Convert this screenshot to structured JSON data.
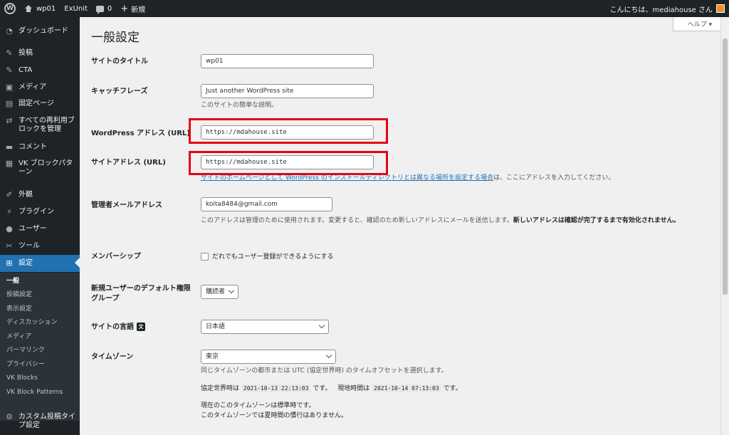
{
  "adminbar": {
    "site_name": "wp01",
    "exunit": "ExUnit",
    "comments_count": "0",
    "new_label": "新規",
    "greeting": "こんにちは、mediahouse さん"
  },
  "sidebar": {
    "dashboard": "ダッシュボード",
    "posts": "投稿",
    "cta": "CTA",
    "media": "メディア",
    "pages": "固定ページ",
    "reusable_blocks": "すべての再利用ブロックを管理",
    "comments": "コメント",
    "vk_block_patterns": "VK ブロックパターン",
    "appearance": "外観",
    "plugins": "プラグイン",
    "users": "ユーザー",
    "tools": "ツール",
    "settings": "設定",
    "submenu": [
      "一般",
      "投稿設定",
      "表示設定",
      "ディスカッション",
      "メディア",
      "パーマリンク",
      "プライバシー",
      "VK Blocks",
      "VK Block Patterns"
    ],
    "custom_post_type": "カスタム投稿タイプ設定"
  },
  "help_label": "ヘルプ ▾",
  "page_title": "一般設定",
  "form": {
    "site_title_label": "サイトのタイトル",
    "site_title_value": "wp01",
    "tagline_label": "キャッチフレーズ",
    "tagline_value": "Just another WordPress site",
    "tagline_desc": "このサイトの簡単な説明。",
    "wp_address_label": "WordPress アドレス (URL)",
    "wp_address_value": "https://mdahouse.site",
    "site_address_label": "サイトアドレス (URL)",
    "site_address_value": "https://mdahouse.site",
    "site_address_desc_link": "サイトのホームページとして WordPress のインストールディレクトリとは異なる場所を設定する場合",
    "site_address_desc_tail": "は、ここにアドレスを入力してください。",
    "admin_email_label": "管理者メールアドレス",
    "admin_email_value": "koita8484@gmail.com",
    "admin_email_desc": "このアドレスは管理のために使用されます。変更すると、確認のため新しいアドレスにメールを送信します。",
    "admin_email_desc_bold": "新しいアドレスは確認が完了するまで有効化されません。",
    "membership_label": "メンバーシップ",
    "membership_checkbox": "だれでもユーザー登録ができるようにする",
    "default_role_label": "新規ユーザーのデフォルト権限グループ",
    "default_role_value": "購読者",
    "language_label": "サイトの言語",
    "language_value": "日本語",
    "timezone_label": "タイムゾーン",
    "timezone_value": "東京",
    "timezone_desc": "同じタイムゾーンの都市または UTC (協定世界時) のタイムオフセットを選択します。",
    "utc_label": "協定世界時は",
    "utc_value": "2021-10-13 22:13:03",
    "utc_tail": "です。",
    "local_label": "現地時間は",
    "local_value": "2021-10-14 07:13:03",
    "local_tail": "です。",
    "standard_time": "現在のこのタイムゾーンは標準時です。",
    "no_dst": "このタイムゾーンでは夏時間の慣行はありません。"
  },
  "colors": {
    "admin_bg": "#1d2327",
    "accent": "#2271b1",
    "highlight_border": "#e60012"
  }
}
